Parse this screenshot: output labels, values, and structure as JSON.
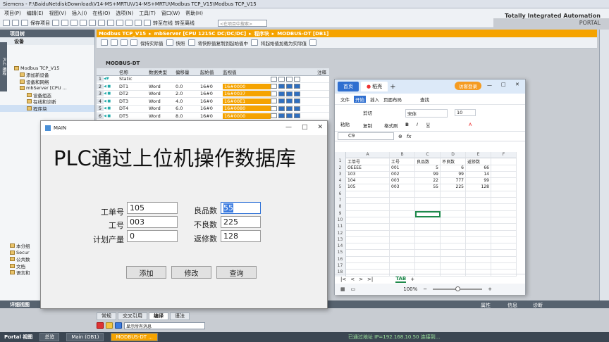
{
  "window": {
    "app": "Siemens",
    "path": "F:\\BaiduNetdiskDownload\\V14-MS+MRTU\\V14-MS+MRTU\\Modbus TCP_V15\\Modbus TCP_V15"
  },
  "menu": [
    "项目(P)",
    "编辑(E)",
    "视图(V)",
    "插入(I)",
    "在线(O)",
    "选项(N)",
    "工具(T)",
    "窗口(W)",
    "帮助(H)"
  ],
  "toolbar": {
    "save_label": "保存项目",
    "goonline": "转至在线",
    "gooffline": "转至离线",
    "search_placeholder": "<在项目中搜索>"
  },
  "brand": {
    "line1": "Totally Integrated Automation",
    "line2": "PORTAL"
  },
  "project_tree": {
    "header": "项目树",
    "devices_tab": "设备",
    "vertical_tab": "PLC 编程",
    "items": [
      {
        "label": "Modbus TCP_V15"
      },
      {
        "label": "添加新设备"
      },
      {
        "label": "设备和网络"
      },
      {
        "label": "mbServer [CPU ..."
      },
      {
        "label": "设备组态"
      },
      {
        "label": "在线和诊断"
      },
      {
        "label": "程序块"
      }
    ],
    "lower_items": [
      "本分组",
      "Secur",
      "公共数",
      "文档",
      "语言和"
    ]
  },
  "breadcrumb": [
    "Modbus TCP_V15",
    "mbServer [CPU 1215C DC/DC/DC]",
    "程序块",
    "MODBUS-DT [DB1]"
  ],
  "editor_toolbar": {
    "keep": "保持实际值",
    "snapshot": "快照",
    "copy_to_start": "将快照值复制到起始值中",
    "load_start": "将起始值加载为实际值"
  },
  "db": {
    "name": "MODBUS-DT",
    "headers": {
      "name": "名称",
      "type": "数据类型",
      "offset": "偏移量",
      "start": "起始值",
      "monitor": "监视值",
      "comment": "注释"
    },
    "rows": [
      {
        "no": "1",
        "name": "Static",
        "type": "",
        "offset": "",
        "start": "",
        "monitor": ""
      },
      {
        "no": "2",
        "name": "DT1",
        "type": "Word",
        "offset": "0.0",
        "start": "16#0",
        "monitor": "16#0000"
      },
      {
        "no": "3",
        "name": "DT2",
        "type": "Word",
        "offset": "2.0",
        "start": "16#0",
        "monitor": "16#0037"
      },
      {
        "no": "4",
        "name": "DT3",
        "type": "Word",
        "offset": "4.0",
        "start": "16#0",
        "monitor": "16#00E1"
      },
      {
        "no": "5",
        "name": "DT4",
        "type": "Word",
        "offset": "6.0",
        "start": "16#0",
        "monitor": "16#0080"
      },
      {
        "no": "6",
        "name": "DT5",
        "type": "Word",
        "offset": "8.0",
        "start": "16#0",
        "monitor": "16#0000"
      }
    ]
  },
  "main_dialog": {
    "title": "MAIN",
    "heading": "PLC通过上位机操作数据库",
    "fields": {
      "order_label": "工单号",
      "order_value": "105",
      "proc_label": "工号",
      "proc_value": "003",
      "plan_label": "计划产量",
      "plan_value": "0",
      "good_label": "良品数",
      "good_value": "55",
      "bad_label": "不良数",
      "bad_value": "225",
      "rework_label": "返修数",
      "rework_value": "128"
    },
    "buttons": {
      "add": "添加",
      "edit": "修改",
      "query": "查询"
    }
  },
  "wps": {
    "tabs": {
      "home": "首页",
      "doc": "稻壳"
    },
    "login": "访客登录",
    "menu": [
      "文件",
      "开始",
      "插入",
      "页面布局",
      "查找"
    ],
    "ribbon": {
      "paste": "粘贴",
      "cut": "剪切",
      "copy": "复制",
      "format": "格式刷",
      "font": "宋体",
      "size": "10"
    },
    "cellref": "C9",
    "fx": "fx",
    "columns": [
      "A",
      "B",
      "C",
      "D",
      "E",
      "F"
    ],
    "rows": [
      [
        "工单号",
        "工号",
        "良品数",
        "不良数",
        "返修数",
        ""
      ],
      [
        "OEEEE",
        "001",
        "5",
        "6",
        "66",
        ""
      ],
      [
        "103",
        "002",
        "99",
        "99",
        "14",
        ""
      ],
      [
        "104",
        "003",
        "22",
        "777",
        "99",
        ""
      ],
      [
        "105",
        "003",
        "55",
        "225",
        "128",
        ""
      ],
      [
        "",
        "",
        "",
        "",
        "",
        ""
      ],
      [
        "",
        "",
        "",
        "",
        "",
        ""
      ],
      [
        "",
        "",
        "",
        "",
        "",
        ""
      ],
      [
        "",
        "",
        "",
        "",
        "",
        ""
      ],
      [
        "",
        "",
        "",
        "",
        "",
        ""
      ],
      [
        "",
        "",
        "",
        "",
        "",
        ""
      ],
      [
        "",
        "",
        "",
        "",
        "",
        ""
      ],
      [
        "",
        "",
        "",
        "",
        "",
        ""
      ],
      [
        "",
        "",
        "",
        "",
        "",
        ""
      ],
      [
        "",
        "",
        "",
        "",
        "",
        ""
      ],
      [
        "",
        "",
        "",
        "",
        "",
        ""
      ],
      [
        "",
        "",
        "",
        "",
        "",
        ""
      ],
      [
        "",
        "",
        "",
        "",
        "",
        ""
      ]
    ],
    "sheet": "TAB",
    "zoom": "100%"
  },
  "inspector": {
    "detail": "详细视图",
    "tabs": [
      "常规",
      "交叉引用",
      "编译",
      "语法"
    ],
    "filter": "显示所有消息",
    "right": [
      "属性",
      "信息",
      "诊断"
    ]
  },
  "statusbar": {
    "portal": "Portal 视图",
    "overview": "总览",
    "main_ob": "Main (OB1)",
    "modbus_dt": "MODBUS-DT ...",
    "connection": "已通过地址 IP=192.168.10.50 连接到..."
  }
}
